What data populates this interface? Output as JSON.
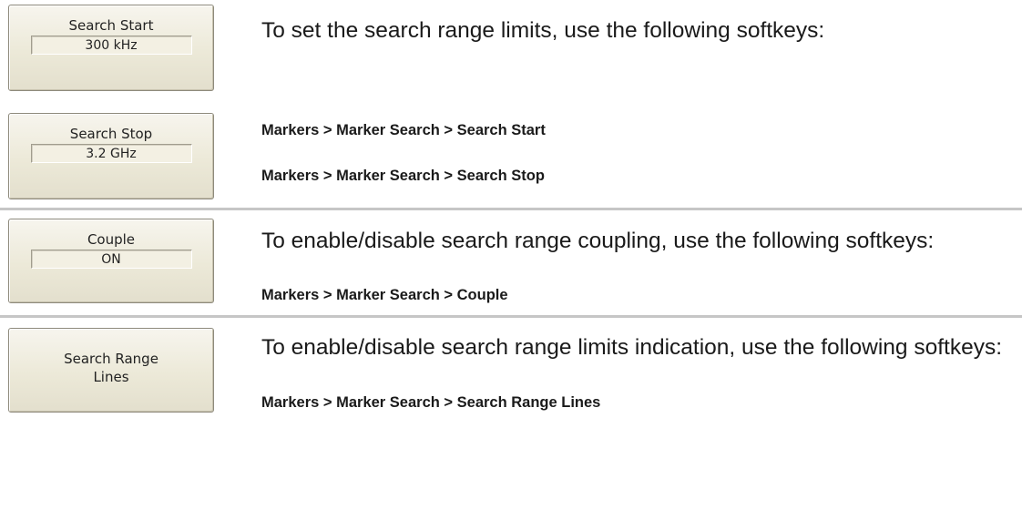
{
  "softkeys": {
    "search_start": {
      "label": "Search Start",
      "value": "300 kHz"
    },
    "search_stop": {
      "label": "Search Stop",
      "value": "3.2 GHz"
    },
    "couple": {
      "label": "Couple",
      "value": "ON"
    },
    "search_range_lines": {
      "label_line1": "Search Range",
      "label_line2": "Lines"
    }
  },
  "sections": [
    {
      "description": "To set the search range limits, use the following softkeys:",
      "paths": [
        "Markers > Marker Search > Search Start",
        "Markers > Marker Search > Search Stop"
      ]
    },
    {
      "description": "To enable/disable search range coupling, use the following softkeys:",
      "paths": [
        "Markers > Marker Search > Couple"
      ]
    },
    {
      "description": "To enable/disable search range limits indication, use the following  softkeys:",
      "paths": [
        "Markers > Marker Search > Search Range Lines"
      ]
    }
  ]
}
